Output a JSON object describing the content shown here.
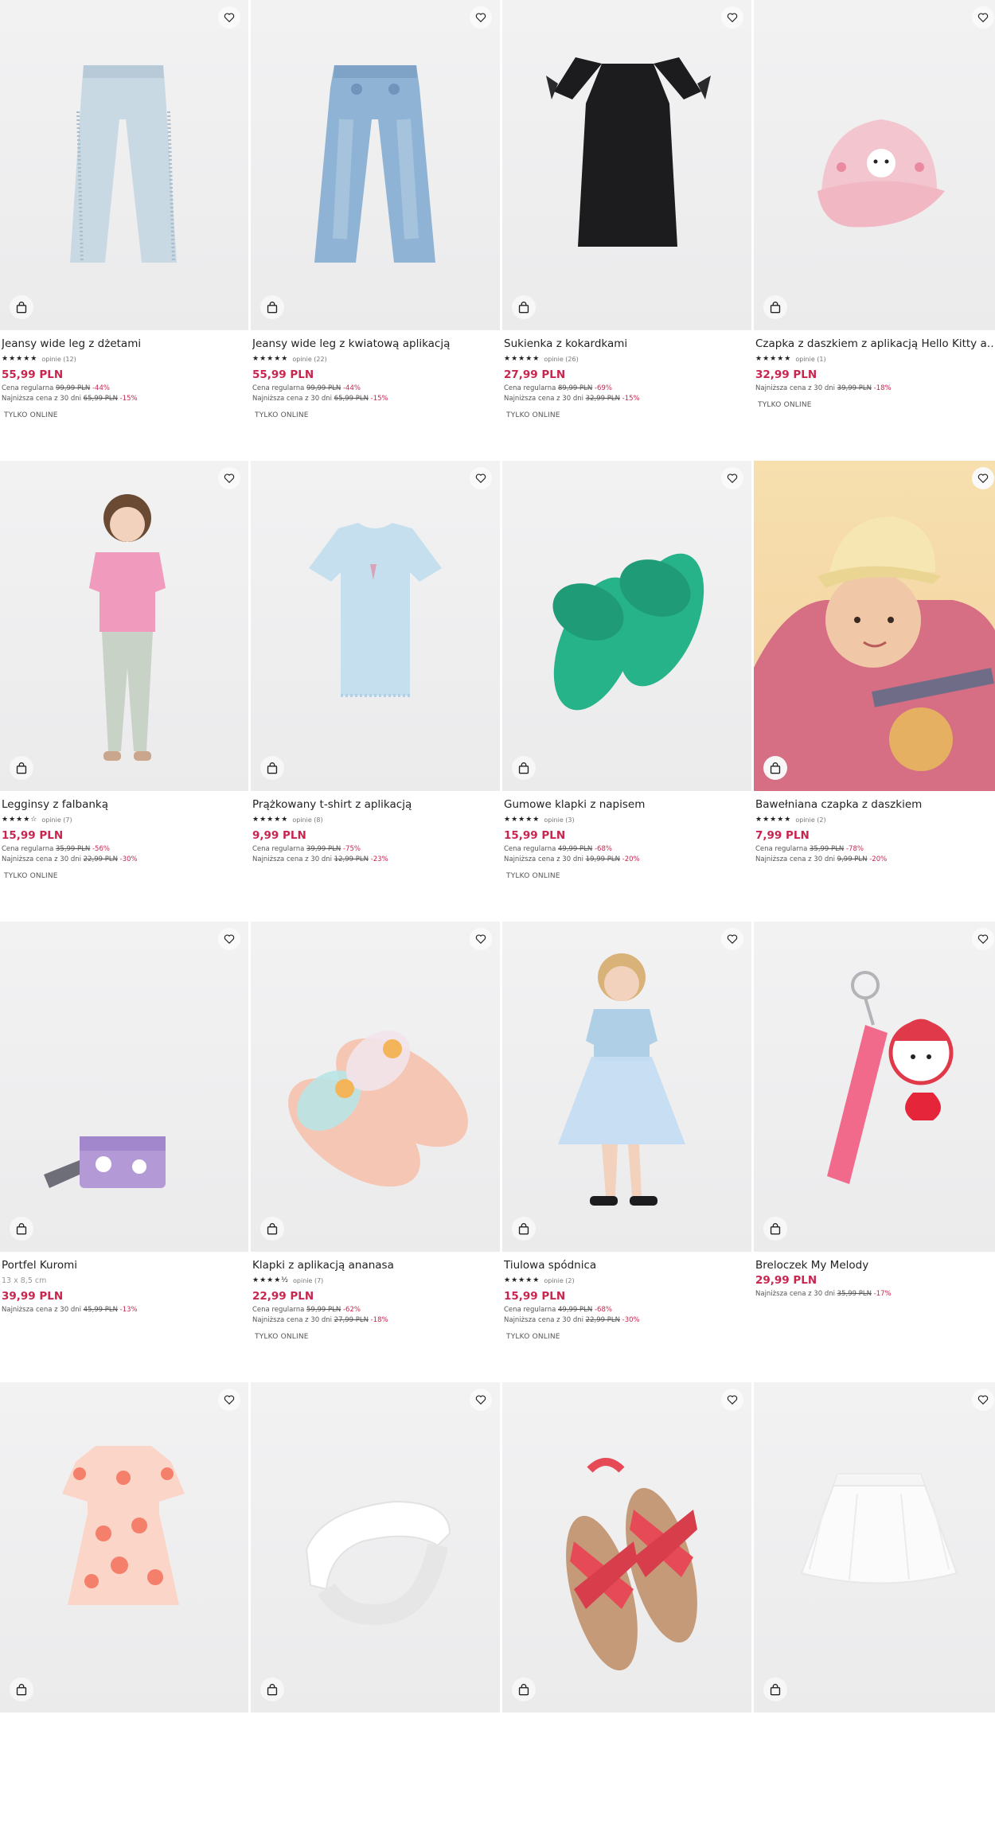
{
  "labels": {
    "regular": "Cena regularna",
    "lowest": "Najniższa cena z 30 dni",
    "online_only": "TYLKO ONLINE"
  },
  "colors": {
    "price": "#c8254f",
    "discount": "#c8254f",
    "text": "#222222"
  },
  "icons": {
    "favorite": "heart-icon",
    "add_to_cart": "shopping-bag-icon"
  },
  "products": [
    {
      "name": "Jeansy wide leg z dżetami",
      "stars": "★★★★★",
      "reviews": "opinie (12)",
      "price": "55,99 PLN",
      "regular_price": "99,99 PLN",
      "regular_discount": "-44%",
      "lowest_price": "65,99 PLN",
      "lowest_discount": "-15%",
      "badge": "TYLKO ONLINE",
      "image": "light-jeans"
    },
    {
      "name": "Jeansy wide leg z kwiatową aplikacją",
      "stars": "★★★★★",
      "reviews": "opinie (22)",
      "price": "55,99 PLN",
      "regular_price": "99,99 PLN",
      "regular_discount": "-44%",
      "lowest_price": "65,99 PLN",
      "lowest_discount": "-15%",
      "badge": "TYLKO ONLINE",
      "image": "blue-jeans"
    },
    {
      "name": "Sukienka z kokardkami",
      "stars": "★★★★★",
      "reviews": "opinie (26)",
      "price": "27,99 PLN",
      "regular_price": "89,99 PLN",
      "regular_discount": "-69%",
      "lowest_price": "32,99 PLN",
      "lowest_discount": "-15%",
      "badge": "TYLKO ONLINE",
      "image": "black-dress"
    },
    {
      "name": "Czapka z daszkiem z aplikacją Hello Kitty and Friends",
      "stars": "★★★★★",
      "reviews": "opinie (1)",
      "price": "32,99 PLN",
      "lowest_price": "39,99 PLN",
      "lowest_discount": "-18%",
      "badge": "TYLKO ONLINE",
      "image": "pink-cap"
    },
    {
      "name": "Legginsy z falbanką",
      "stars": "★★★★☆",
      "reviews": "opinie (7)",
      "price": "15,99 PLN",
      "regular_price": "35,99 PLN",
      "regular_discount": "-56%",
      "lowest_price": "22,99 PLN",
      "lowest_discount": "-30%",
      "badge": "TYLKO ONLINE",
      "image": "girl-leggings"
    },
    {
      "name": "Prążkowany t-shirt z aplikacją",
      "stars": "★★★★★",
      "reviews": "opinie (8)",
      "price": "9,99 PLN",
      "regular_price": "39,99 PLN",
      "regular_discount": "-75%",
      "lowest_price": "12,99 PLN",
      "lowest_discount": "-23%",
      "image": "blue-tshirt"
    },
    {
      "name": "Gumowe klapki z napisem",
      "stars": "★★★★★",
      "reviews": "opinie (3)",
      "price": "15,99 PLN",
      "regular_price": "49,99 PLN",
      "regular_discount": "-68%",
      "lowest_price": "19,99 PLN",
      "lowest_discount": "-20%",
      "badge": "TYLKO ONLINE",
      "image": "green-slides"
    },
    {
      "name": "Bawełniana czapka z daszkiem",
      "stars": "★★★★★",
      "reviews": "opinie (2)",
      "price": "7,99 PLN",
      "regular_price": "35,99 PLN",
      "regular_discount": "-78%",
      "lowest_price": "9,99 PLN",
      "lowest_discount": "-20%",
      "image": "girl-cap"
    },
    {
      "name": "Portfel Kuromi",
      "size": "13 x 8,5 cm",
      "price": "39,99 PLN",
      "lowest_price": "45,99 PLN",
      "lowest_discount": "-13%",
      "image": "purple-wallet"
    },
    {
      "name": "Klapki z aplikacją ananasa",
      "stars": "★★★★½",
      "reviews": "opinie (7)",
      "price": "22,99 PLN",
      "regular_price": "59,99 PLN",
      "regular_discount": "-62%",
      "lowest_price": "27,99 PLN",
      "lowest_discount": "-18%",
      "badge": "TYLKO ONLINE",
      "image": "pink-slides"
    },
    {
      "name": "Tiulowa spódnica",
      "stars": "★★★★★",
      "reviews": "opinie (2)",
      "price": "15,99 PLN",
      "regular_price": "49,99 PLN",
      "regular_discount": "-68%",
      "lowest_price": "22,99 PLN",
      "lowest_discount": "-30%",
      "badge": "TYLKO ONLINE",
      "image": "girl-tulle"
    },
    {
      "name": "Breloczek My Melody",
      "price": "29,99 PLN",
      "lowest_price": "35,99 PLN",
      "lowest_discount": "-17%",
      "image": "keychain"
    },
    {
      "name": "",
      "price": "",
      "image": "floral-dress"
    },
    {
      "name": "",
      "price": "",
      "image": "white-headband"
    },
    {
      "name": "",
      "price": "",
      "image": "red-sandals"
    },
    {
      "name": "",
      "price": "",
      "image": "white-tulle"
    }
  ]
}
